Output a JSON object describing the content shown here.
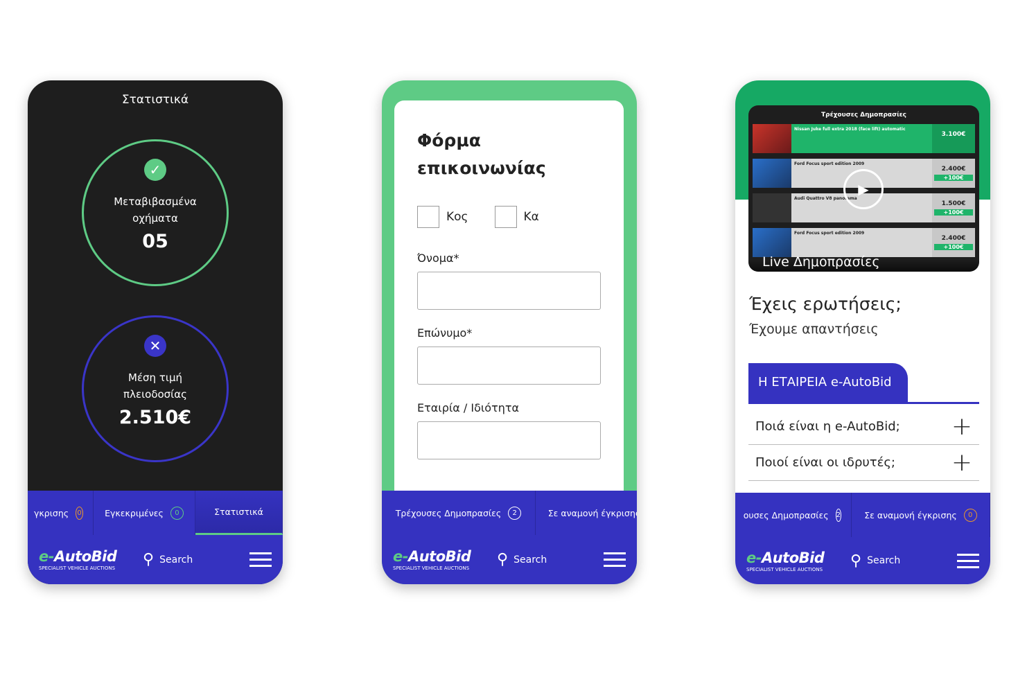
{
  "brand": {
    "name_prefix": "e-",
    "name": "AutoBid",
    "tagline": "SPECIALIST VEHICLE AUCTIONS",
    "search": "Search",
    "colors": {
      "primary": "#3532c0",
      "green": "#5ecb85",
      "dark": "#1e1e1e"
    }
  },
  "stats": {
    "title": "Στατιστικά",
    "transferred_label": "Μεταβιβασμένα οχήματα",
    "transferred_value": "05",
    "avg_label": "Μέση τιμή πλειοδοσίας",
    "avg_value": "2.510€",
    "tabs": [
      {
        "label": "γκρισης",
        "count": "0"
      },
      {
        "label": "Εγκεκριμένες",
        "count": "0"
      },
      {
        "label": "Στατιστικά"
      }
    ]
  },
  "form": {
    "title": "Φόρμα επικοινωνίας",
    "options": [
      "Κος",
      "Κα"
    ],
    "fields": [
      "Όνομα*",
      "Επώνυμο*",
      "Εταιρία / Ιδιότητα"
    ],
    "tabs": [
      {
        "label": "Τρέχουσες Δημοπρασίες",
        "count": "2"
      },
      {
        "label": "Σε αναμονή έγκρισης"
      }
    ]
  },
  "faq": {
    "video_title": "Τρέχουσες Δημοπρασίες",
    "video_caption": "Live Δημοπρασίες",
    "listings": [
      {
        "name": "Nissan Juke full extra 2018 (face lift) automatic",
        "price": "3.100€"
      },
      {
        "name": "Ford Focus sport edition 2009",
        "price": "2.400€",
        "bid": "+100€"
      },
      {
        "name": "Audi Quattro V8 panorama",
        "price": "1.500€",
        "bid": "+100€"
      },
      {
        "name": "Ford Focus sport edition 2009",
        "price": "2.400€",
        "bid": "+100€"
      }
    ],
    "heading": "Έχεις ερωτήσεις;",
    "subheading": "Έχουμε απαντήσεις",
    "category": "Η ΕΤΑΙΡΕΙΑ e-AutoBid",
    "questions": [
      "Ποιά είναι η e-AutoBid;",
      "Ποιοί είναι οι ιδρυτές;"
    ],
    "tabs": [
      {
        "label": "ουσες Δημοπρασίες",
        "count": "2"
      },
      {
        "label": "Σε αναμονή έγκρισης",
        "count": "0"
      }
    ]
  }
}
